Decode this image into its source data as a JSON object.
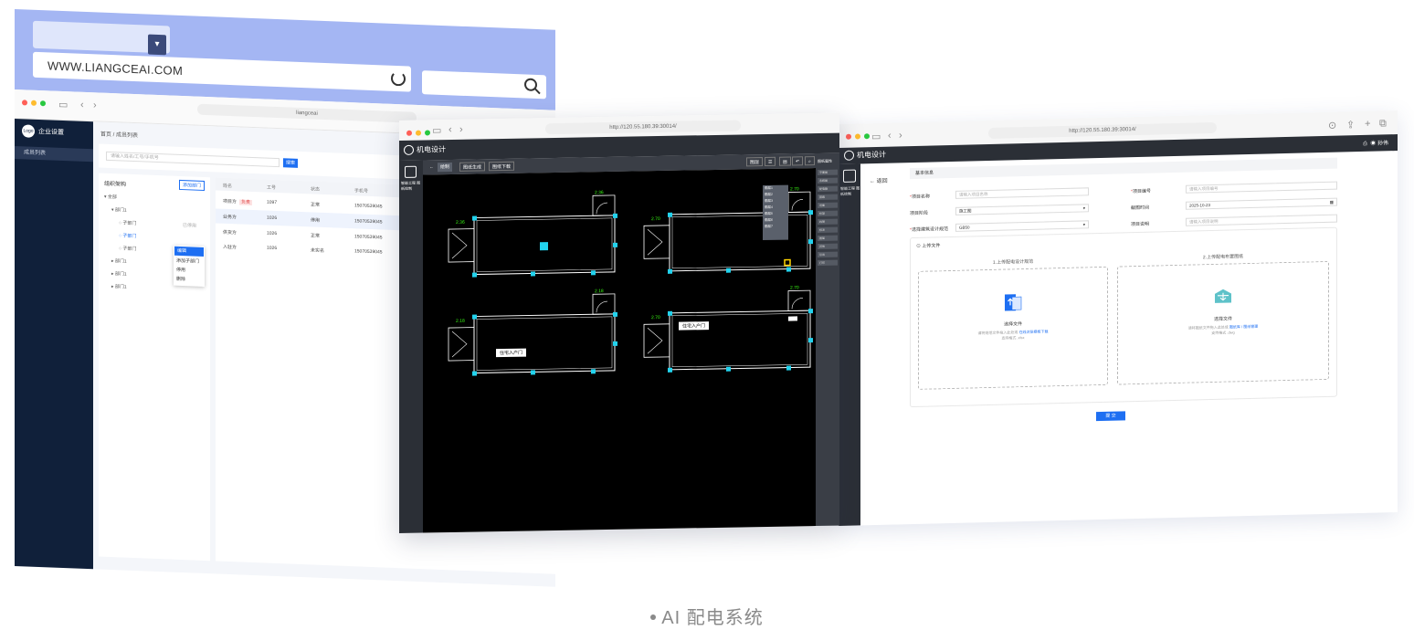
{
  "caption": "AI 配电系统",
  "window1": {
    "address_url": "WWW.LIANGCEAI.COM",
    "tab_url": "liangceai",
    "sidebar_title": "企业设置",
    "sidebar_logo": "Logo",
    "sidebar_item": "成员列表",
    "breadcrumb": "首页 / 成员列表",
    "search_placeholder": "请输入姓名/工号/手机号",
    "search_button": "搜索",
    "org_title": "组织架构",
    "add_dept": "添加部门",
    "tree": [
      "全部",
      "部门1",
      "子部门",
      "子部门",
      "子部门",
      "部门1",
      "部门1",
      "部门1"
    ],
    "tree_badge": "已停用",
    "context_menu": [
      "编辑",
      "添加子部门",
      "停用",
      "删除"
    ],
    "table_headers": [
      "姓名",
      "工号",
      "状态",
      "手机号"
    ],
    "table_rows": [
      {
        "name": "项目方",
        "badge": "负责",
        "id": "1097",
        "status": "正常",
        "phone": "15070539045"
      },
      {
        "name": "业务方",
        "badge": "",
        "id": "1026",
        "status": "停用",
        "phone": "15070539045"
      },
      {
        "name": "供货方",
        "badge": "",
        "id": "1026",
        "status": "正常",
        "phone": "15070539045"
      },
      {
        "name": "入驻方",
        "badge": "",
        "id": "1026",
        "status": "未实名",
        "phone": "15070539045"
      }
    ]
  },
  "window2": {
    "tab_url": "http://120.55.180.39:30014/",
    "app_name": "机电设计",
    "side_label": "智能工程 图纸绘制",
    "toolbar": [
      "绘制",
      "图纸生成",
      "图纸下载"
    ],
    "right_panel_title": "图纸属性",
    "right_panel_items": [
      "平面图",
      "系统图",
      "配电箱",
      "回路",
      "设备",
      "桥架",
      "线管",
      "标注",
      "图层",
      "其他",
      "导出",
      "打印"
    ],
    "layer_popup": [
      "图层",
      "图层1",
      "图层2",
      "图层3",
      "图层4",
      "图层5",
      "图层6",
      "图层7"
    ],
    "tags": [
      "住宅入户门",
      "住宅入户门"
    ],
    "dims": [
      "2.36",
      "2.36",
      "2.70",
      "2.70",
      "2.18",
      "2.18",
      "2.70",
      "2.70"
    ],
    "colors": {
      "cad_line": "#ffffff",
      "cad_dim": "#39ff14",
      "cad_node": "#22d3ee",
      "cad_warn": "#ffd400"
    }
  },
  "window3": {
    "tab_url": "http://120.55.180.39:30014/",
    "app_name": "机电设计",
    "user": "孙伟",
    "side_label": "智能工程 图纸绘制",
    "back": "返回",
    "section_basic": "基本信息",
    "fields": [
      {
        "label": "项目名称",
        "req": true,
        "value": "请输入项目名称",
        "filled": false
      },
      {
        "label": "项目阶段",
        "req": false,
        "value": "施工图",
        "filled": true
      },
      {
        "label": "选择建筑设计规范",
        "req": true,
        "value": "GB50",
        "filled": true
      },
      {
        "label": "项目编号",
        "req": true,
        "value": "请输入项目编号",
        "filled": false
      },
      {
        "label": "截图时间",
        "req": false,
        "value": "2025-10-23",
        "filled": true
      },
      {
        "label": "项目说明",
        "req": false,
        "value": "请输入项目说明",
        "filled": false
      }
    ],
    "section_upload": "上传文件",
    "upload1": {
      "title": "1.上传配电设计规范",
      "select": "选择文件",
      "tip": "请将规范文件拖入此处或",
      "link": "在线浏览模板下载",
      "fmt": "支持格式 .xlsx"
    },
    "upload2": {
      "title": "2.上传配电布置图纸",
      "select": "选择文件",
      "tip": "请将图纸文件拖入此处或",
      "link": "图纸库 / 图纸管理",
      "fmt": "支持格式 .dwg"
    },
    "submit": "提 交",
    "accent": "#1e6ff2"
  }
}
